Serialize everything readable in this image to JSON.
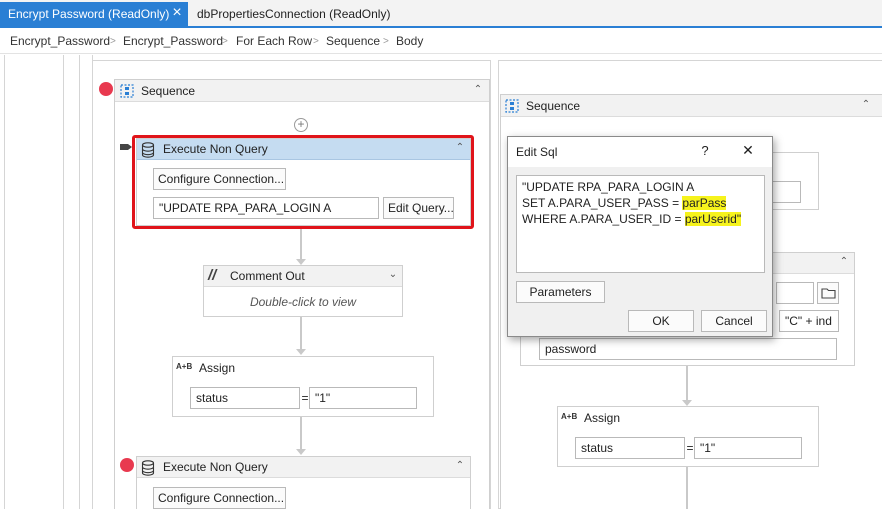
{
  "tabs": [
    {
      "label": "Encrypt Password (ReadOnly)",
      "active": true
    },
    {
      "label": "dbPropertiesConnection (ReadOnly)",
      "active": false
    }
  ],
  "breadcrumb": [
    "Encrypt_Password",
    "Encrypt_Password",
    "For Each Row",
    "Sequence",
    "Body"
  ],
  "left": {
    "sequence_title": "Sequence",
    "exec1": {
      "title": "Execute Non Query",
      "configure": "Configure Connection...",
      "sql": "\"UPDATE RPA_PARA_LOGIN A",
      "edit": "Edit Query..."
    },
    "comment": {
      "title": "Comment Out",
      "hint": "Double-click to view"
    },
    "assign": {
      "title": "Assign",
      "to": "status",
      "eq": "=",
      "value": "\"1\""
    },
    "exec2": {
      "title": "Execute Non Query",
      "configure": "Configure Connection..."
    }
  },
  "right": {
    "sequence_title": "Sequence",
    "right_field": "\"C\" + ind",
    "password": "password",
    "assign": {
      "title": "Assign",
      "to": "status",
      "eq": "=",
      "value": "\"1\""
    }
  },
  "dialog": {
    "title": "Edit Sql",
    "help": "?",
    "close": "✕",
    "sql_line1": "\"UPDATE RPA_PARA_LOGIN A",
    "sql_line2_prefix": "SET A.PARA_USER_PASS = ",
    "sql_line2_param": "parPass",
    "sql_line3_prefix": "WHERE A.PARA_USER_ID = ",
    "sql_line3_param": "parUserid\"",
    "parameters": "Parameters",
    "ok": "OK",
    "cancel": "Cancel"
  },
  "colors": {
    "accent": "#2a7fd4",
    "selection": "#e0141a",
    "breakpoint": "#e8394f",
    "highlight": "#f6f31c",
    "header_selected": "#c5dcf1"
  }
}
